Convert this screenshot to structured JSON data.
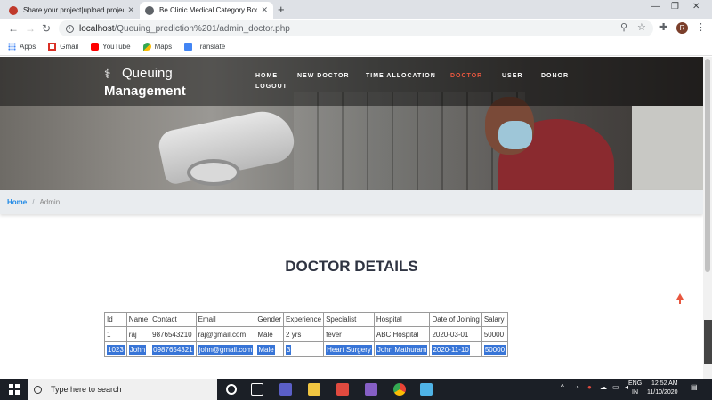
{
  "browser": {
    "tabs": [
      {
        "title": "Share your project|upload projec",
        "active": false
      },
      {
        "title": "Be Clinic Medical Category Boots",
        "active": true
      }
    ],
    "url_host": "localhost",
    "url_path": "/Queuing_prediction%201/admin_doctor.php",
    "avatar_letter": "R",
    "bookmarks": [
      {
        "label": "Apps",
        "icon": "apps-icon"
      },
      {
        "label": "Gmail",
        "icon": "gmail-icon"
      },
      {
        "label": "YouTube",
        "icon": "youtube-icon"
      },
      {
        "label": "Maps",
        "icon": "maps-icon"
      },
      {
        "label": "Translate",
        "icon": "translate-icon"
      }
    ]
  },
  "site": {
    "brand_line1": "Queuing",
    "brand_line2": "Management",
    "menu": [
      {
        "label": "HOME",
        "active": false
      },
      {
        "label": "NEW DOCTOR",
        "active": false
      },
      {
        "label": "TIME ALLOCATION",
        "active": false
      },
      {
        "label": "DOCTOR",
        "active": true
      },
      {
        "label": "USER",
        "active": false
      },
      {
        "label": "DONOR",
        "active": false
      },
      {
        "label": "LOGOUT",
        "active": false
      }
    ],
    "accent_color": "#e8573f"
  },
  "breadcrumb": {
    "home": "Home",
    "separator": "/",
    "current": "Admin"
  },
  "page_title": "DOCTOR DETAILS",
  "table": {
    "columns": [
      "Id",
      "Name",
      "Contact",
      "Email",
      "Gender",
      "Experience",
      "Specialist",
      "Hospital",
      "Date of Joining",
      "Salary"
    ],
    "rows": [
      [
        "1",
        "raj",
        "9876543210",
        "raj@gmail.com",
        "Male",
        "2 yrs",
        "fever",
        "ABC Hospital",
        "2020-03-01",
        "50000"
      ],
      [
        "1023",
        "John",
        "0987654321",
        "john@gmail.com",
        "Male",
        "3",
        "Heart Surgery",
        "John Mathuram",
        "2020-11-10",
        "50000"
      ]
    ],
    "selected_row": 1
  },
  "taskbar": {
    "search_placeholder": "Type here to search",
    "lang1": "ENG",
    "lang2": "IN",
    "time": "12:52 AM",
    "date": "11/10/2020"
  }
}
